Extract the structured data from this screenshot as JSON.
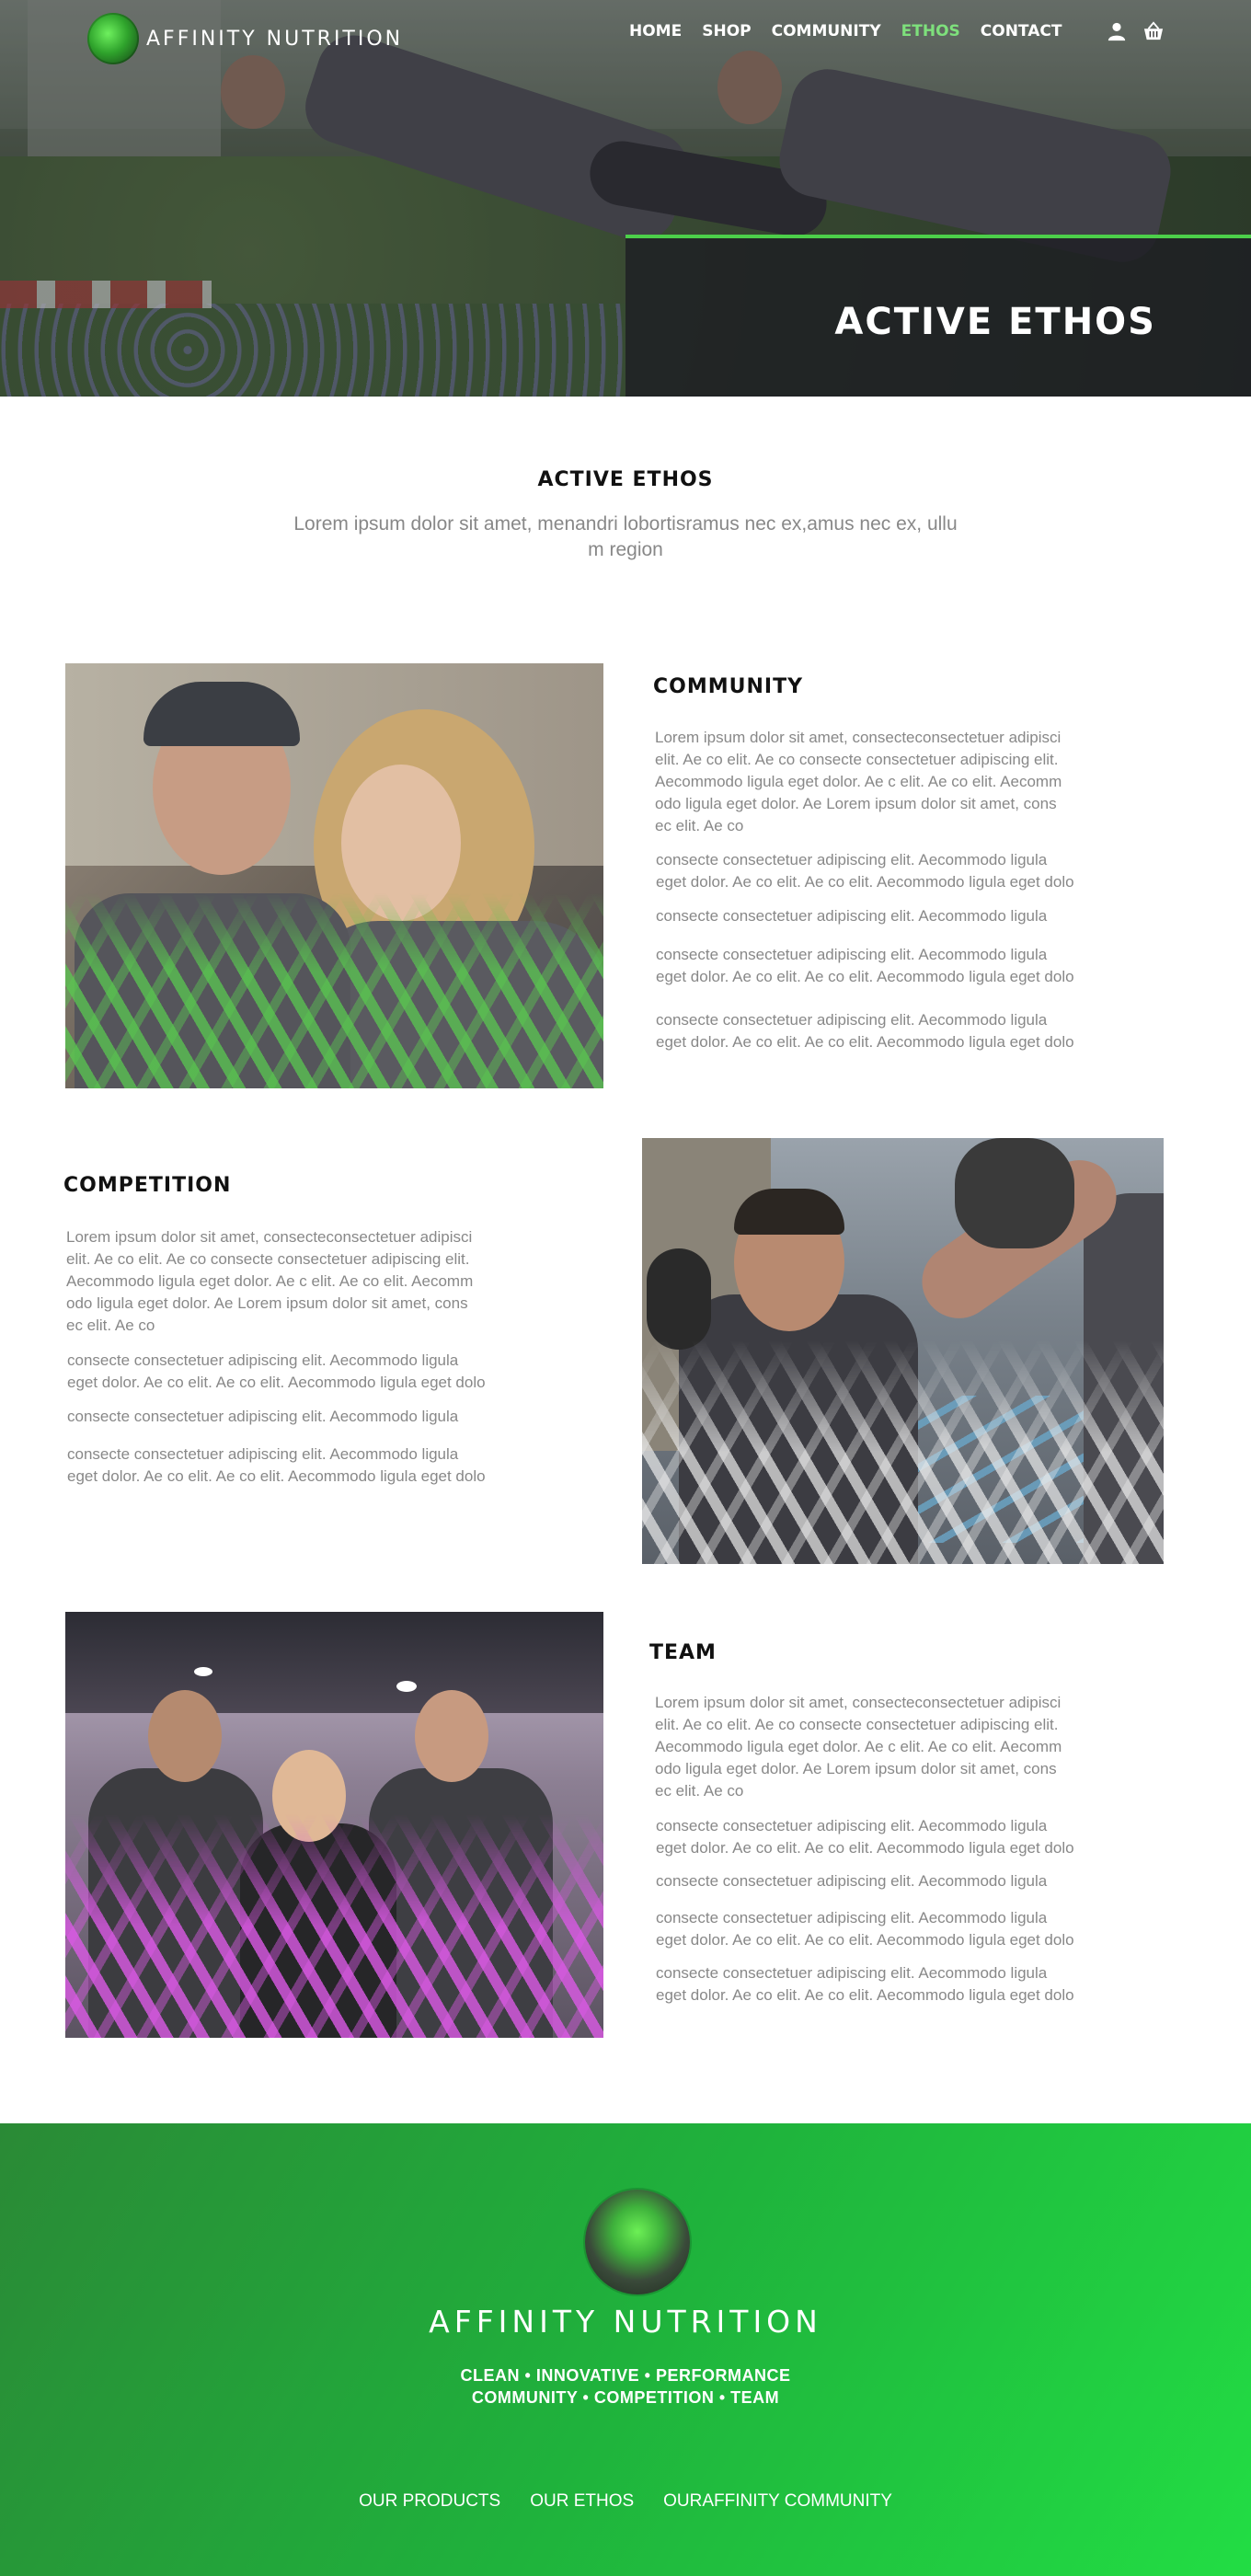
{
  "brand": {
    "name": "AFFINITY NUTRITION"
  },
  "nav": {
    "items": [
      {
        "label": "HOME",
        "active": false
      },
      {
        "label": "SHOP",
        "active": false
      },
      {
        "label": "COMMUNITY",
        "active": false
      },
      {
        "label": "ETHOS",
        "active": true
      },
      {
        "label": "CONTACT",
        "active": false
      }
    ],
    "icons": [
      "user-icon",
      "basket-icon"
    ]
  },
  "hero": {
    "title": "ACTIVE ETHOS",
    "accent": "#4ccf4a"
  },
  "intro": {
    "title": "ACTIVE ETHOS",
    "subtitle_line1": "Lorem ipsum dolor sit amet, menandri lobortisramus nec ex,amus nec ex, ullu",
    "subtitle_line2": "m region"
  },
  "sections": [
    {
      "title": "COMMUNITY",
      "lead": [
        "Lorem ipsum dolor sit amet, consecteconsectetuer adipisci",
        "elit. Ae co elit. Ae co consecte consectetuer adipiscing elit.",
        "Aecommodo ligula eget dolor. Ae c elit. Ae co elit. Aecomm",
        "odo ligula eget dolor. Ae Lorem ipsum dolor sit amet, cons",
        "ec elit. Ae co"
      ],
      "paras": [
        [
          "consecte consectetuer adipiscing elit. Aecommodo ligula",
          "eget dolor. Ae co elit. Ae co elit. Aecommodo ligula eget dolo"
        ],
        [
          "consecte consectetuer adipiscing elit. Aecommodo ligula"
        ],
        [
          "consecte consectetuer adipiscing elit. Aecommodo ligula",
          "eget dolor. Ae co elit. Ae co elit. Aecommodo ligula eget dolo"
        ],
        [
          "consecte consectetuer adipiscing elit. Aecommodo ligula",
          "eget dolor. Ae co elit. Ae co elit. Aecommodo ligula eget dolo"
        ]
      ]
    },
    {
      "title": "COMPETITION",
      "lead": [
        "Lorem ipsum dolor sit amet, consecteconsectetuer adipisci",
        "elit. Ae co elit. Ae co consecte consectetuer adipiscing elit.",
        "Aecommodo ligula eget dolor. Ae c elit. Ae co elit. Aecomm",
        "odo ligula eget dolor. Ae Lorem ipsum dolor sit amet, cons",
        "ec elit. Ae co"
      ],
      "paras": [
        [
          "consecte consectetuer adipiscing elit. Aecommodo ligula",
          "eget dolor. Ae co elit. Ae co elit. Aecommodo ligula eget dolo"
        ],
        [
          "consecte consectetuer adipiscing elit. Aecommodo ligula"
        ],
        [
          "consecte consectetuer adipiscing elit. Aecommodo ligula",
          "eget dolor. Ae co elit. Ae co elit. Aecommodo ligula eget dolo"
        ]
      ]
    },
    {
      "title": "TEAM",
      "lead": [
        "Lorem ipsum dolor sit amet, consecteconsectetuer adipisci",
        "elit. Ae co elit. Ae co consecte consectetuer adipiscing elit.",
        "Aecommodo ligula eget dolor. Ae c elit. Ae co elit. Aecomm",
        "odo ligula eget dolor. Ae Lorem ipsum dolor sit amet, cons",
        "ec elit. Ae co"
      ],
      "paras": [
        [
          "consecte consectetuer adipiscing elit. Aecommodo ligula",
          "eget dolor. Ae co elit. Ae co elit. Aecommodo ligula eget dolo"
        ],
        [
          "consecte consectetuer adipiscing elit. Aecommodo ligula"
        ],
        [
          "consecte consectetuer adipiscing elit. Aecommodo ligula",
          "eget dolor. Ae co elit. Ae co elit. Aecommodo ligula eget dolo"
        ],
        [
          "consecte consectetuer adipiscing elit. Aecommodo ligula",
          "eget dolor. Ae co elit. Ae co elit. Aecommodo ligula eget dolo"
        ]
      ]
    }
  ],
  "footer": {
    "brand": "AFFINITY NUTRITION",
    "tagline1": "CLEAN • INNOVATIVE • PERFORMANCE",
    "tagline2": "COMMUNITY • COMPETITION • TEAM",
    "links": [
      "OUR PRODUCTS",
      "OUR ETHOS",
      "OURAFFINITY COMMUNITY"
    ],
    "gradient_start": "#2a8a36",
    "gradient_end": "#22dd44"
  }
}
